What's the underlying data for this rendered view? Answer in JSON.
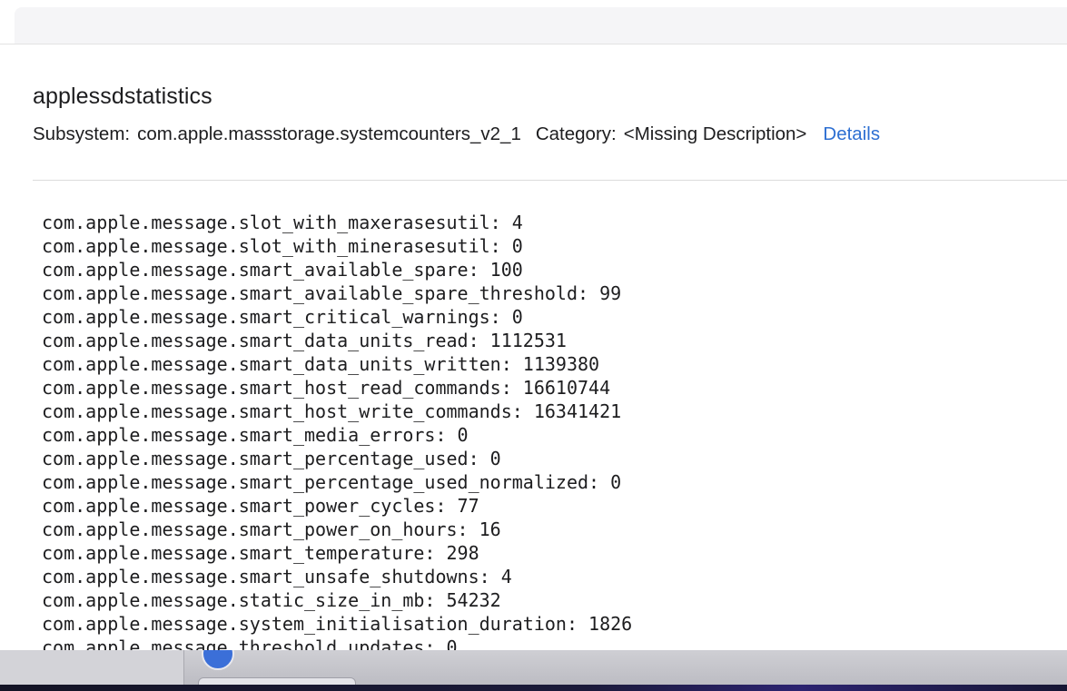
{
  "entry": {
    "title": "applessdstatistics",
    "subsystem_label": "Subsystem:",
    "subsystem_value": "com.apple.massstorage.systemcounters_v2_1",
    "category_label": "Category:",
    "category_value": "<Missing Description>",
    "details_link": "Details"
  },
  "log_lines": [
    "com.apple.message.slot_with_maxerasesutil: 4",
    "com.apple.message.slot_with_minerasesutil: 0",
    "com.apple.message.smart_available_spare: 100",
    "com.apple.message.smart_available_spare_threshold: 99",
    "com.apple.message.smart_critical_warnings: 0",
    "com.apple.message.smart_data_units_read: 1112531",
    "com.apple.message.smart_data_units_written: 1139380",
    "com.apple.message.smart_host_read_commands: 16610744",
    "com.apple.message.smart_host_write_commands: 16341421",
    "com.apple.message.smart_media_errors: 0",
    "com.apple.message.smart_percentage_used: 0",
    "com.apple.message.smart_percentage_used_normalized: 0",
    "com.apple.message.smart_power_cycles: 77",
    "com.apple.message.smart_power_on_hours: 16",
    "com.apple.message.smart_temperature: 298",
    "com.apple.message.smart_unsafe_shutdowns: 4",
    "com.apple.message.static_size_in_mb: 54232",
    "com.apple.message.system_initialisation_duration: 1826",
    "com.apple.message.threshold_updates: 0"
  ],
  "colors": {
    "link": "#2d6fd2",
    "text": "#1d1d1f"
  }
}
